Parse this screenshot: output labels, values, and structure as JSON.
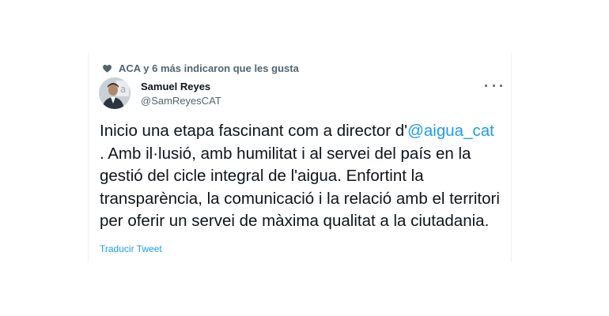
{
  "social_context": {
    "text": "ACA y 6 más indicaron que les gusta",
    "icon": "heart-icon"
  },
  "author": {
    "name": "Samuel Reyes",
    "handle": "@SamReyesCAT"
  },
  "more_menu": {
    "icon": "more-horizontal-icon"
  },
  "tweet": {
    "text_before": "Inicio una etapa fascinant com a director d'",
    "mention": "@aigua_cat",
    "line_break_text": ". Amb il·lusió, amb humilitat i al servei del país en la gestió del cicle integral de l'aigua. Enfortint la transparència, la comunicació i la relació amb el territori per oferir un servei de màxima qualitat a la ciutadania."
  },
  "translate_link": "Traducir Tweet",
  "colors": {
    "accent": "#1d9bf0",
    "text": "#0f1419",
    "secondary": "#536471"
  }
}
